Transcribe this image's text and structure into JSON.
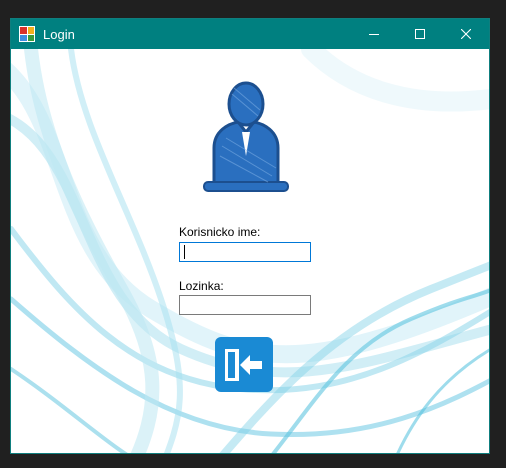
{
  "window": {
    "title": "Login",
    "titlebar_color": "#008080",
    "app_icon": "windows-form-icon",
    "controls": {
      "minimize_icon": "minimize-icon",
      "maximize_icon": "maximize-icon",
      "close_icon": "close-icon"
    }
  },
  "form": {
    "avatar_icon": "user-avatar-icon",
    "username_label": "Korisnicko ime:",
    "username_value": "",
    "password_label": "Lozinka:",
    "password_value": "",
    "login_icon": "login-arrow-icon",
    "accent_color": "#1a8ad4"
  }
}
